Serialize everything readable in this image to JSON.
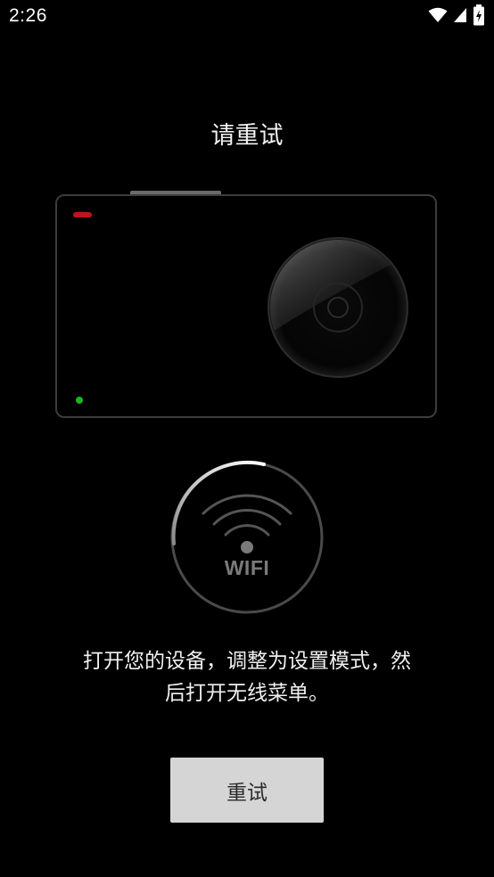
{
  "status_bar": {
    "time": "2:26",
    "icons": [
      "wifi-icon",
      "cell-signal-icon",
      "battery-charging-icon"
    ]
  },
  "page": {
    "title": "请重试",
    "wifi_label": "WIFI",
    "instruction_line1": "打开您的设备，调整为设置模式，然",
    "instruction_line2": "后打开无线菜单。",
    "retry_label": "重试"
  },
  "colors": {
    "background": "#000000",
    "button_bg": "#d4d5d4",
    "red_led": "#c0141a",
    "green_led": "#1cb51c",
    "ring_gray": "#4a4a4a"
  }
}
